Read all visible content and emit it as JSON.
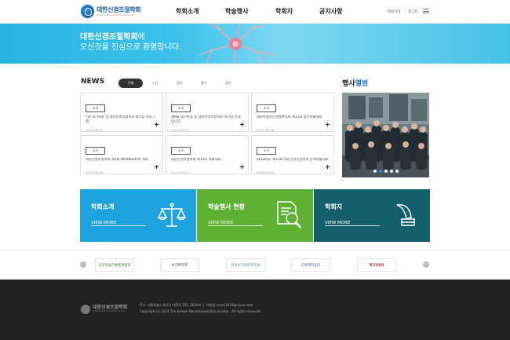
{
  "header": {
    "logo_ko": "대한신경조절학회",
    "logo_en": "Korean Neuromodulation Society",
    "nav": [
      "학회소개",
      "학술행사",
      "학회지",
      "공지사항"
    ],
    "util": [
      "회원가입",
      "로그인"
    ]
  },
  "hero": {
    "title_bold": "대한신경조절학회",
    "title_rest": "에",
    "subtitle": "오신것을 진심으로 환영합니다."
  },
  "news": {
    "title": "NEWS",
    "tabs": [
      "전체",
      "소식",
      "공지",
      "접수",
      "공지"
    ],
    "cards": [
      {
        "tag": "소식",
        "title": "7회 의기투합 및 대한신경조절학회 워크샵 프로그램",
        "date": "2023-08-12"
      },
      {
        "tag": "소식",
        "title": "제6회 의기투합 및 대한신경조절학회 워크샵 안내 입니다.",
        "date": "2022-08-18"
      },
      {
        "tag": "소식",
        "title": "대한퇴행성신경질환학회 제13회 정기학술대회",
        "date": "2021-09-08"
      },
      {
        "tag": "소식",
        "title": "대한신경조절학회 제1회 WORKSHOP 개최",
        "date": "2021-08-19"
      },
      {
        "tag": "소식",
        "title": "대한신경조절학회 제14차 학술대회",
        "date": "2021-03-23"
      },
      {
        "tag": "소식",
        "title": "2018년도 제13회 대한신경조절학회 춘계학술대회",
        "date": "2018-04-26"
      }
    ]
  },
  "album": {
    "title_a": "행사",
    "title_b": "앨범"
  },
  "banners": [
    {
      "title": "학회소개",
      "more": "VIEW MORE",
      "color": "#1fa3df"
    },
    {
      "title": "학술행사 현황",
      "more": "VIEW MORE",
      "color": "#5fb133"
    },
    {
      "title": "학회지",
      "more": "VIEW MORE",
      "color": "#135f6c"
    }
  ],
  "partners": [
    "한국학술단체총연합회",
    "보건복지부",
    "한국보건의료연구원",
    "근로복지공단",
    "파크로ER"
  ],
  "footer": {
    "logo_ko": "대한신경조절학회",
    "logo_en": "Korean Neuromodulation Society",
    "address": "주소: 서울특별시 종로구 대학로 101, 2620호",
    "email": "이메일: kmns2019@naver.com",
    "copyright": "Copyright (c) 2014 The Korean Neuromodulation Society . All rights reserved."
  }
}
